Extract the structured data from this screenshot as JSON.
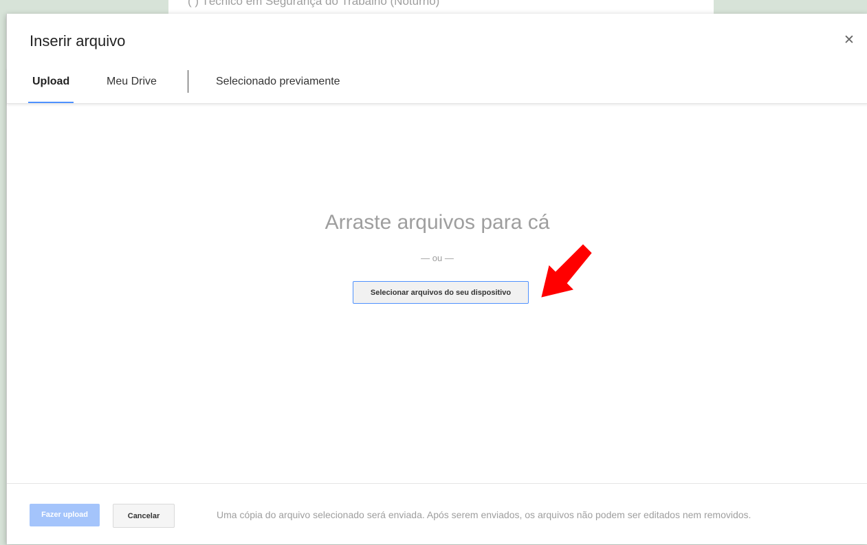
{
  "background": {
    "text": "(    )  Técnico em Segurança do Trabalho (Noturno)"
  },
  "dialog": {
    "title": "Inserir arquivo",
    "close_icon": "close-icon"
  },
  "tabs": [
    {
      "label": "Upload",
      "active": true
    },
    {
      "label": "Meu Drive",
      "active": false
    },
    {
      "label": "Selecionado previamente",
      "active": false
    }
  ],
  "dropzone": {
    "title": "Arraste arquivos para cá",
    "or": "— ou —",
    "select_button": "Selecionar arquivos do seu dispositivo",
    "annotation_icon": "red-arrow-icon"
  },
  "footer": {
    "upload_button": "Fazer upload",
    "cancel_button": "Cancelar",
    "note": "Uma cópia do arquivo selecionado será enviada. Após serem enviados, os arquivos não podem ser editados nem removidos."
  },
  "colors": {
    "accent": "#4d90fe",
    "upload_disabled": "#a4c4fb",
    "annotation": "#ff0000"
  }
}
